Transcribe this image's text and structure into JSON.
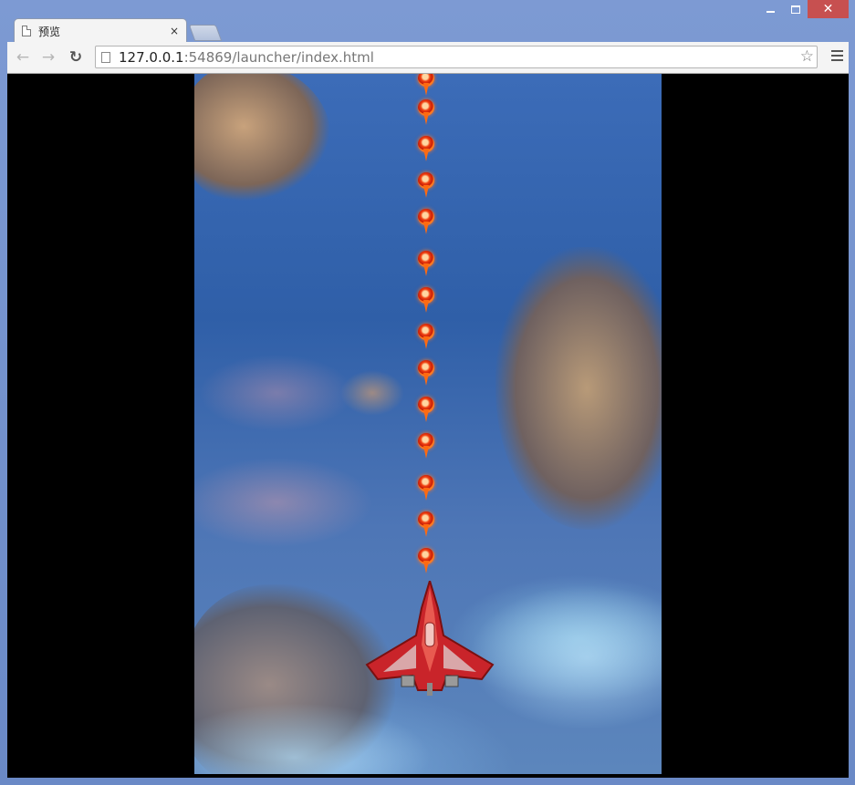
{
  "browser": {
    "tab": {
      "title": "预览",
      "close_glyph": "×"
    },
    "window_controls": {
      "minimize_icon": "minimize-icon",
      "maximize_icon": "maximize-icon",
      "close_glyph": "✕"
    },
    "toolbar": {
      "back_glyph": "←",
      "forward_glyph": "→",
      "reload_glyph": "↻",
      "url_host": "127.0.0.1",
      "url_rest": ":54869/launcher/index.html",
      "star_glyph": "☆"
    },
    "colors": {
      "frame": "#6f8ec9",
      "close_button": "#c75050",
      "viewport": "#000000"
    }
  },
  "game": {
    "bullet_count": 14,
    "player": {
      "name": "red-fighter-jet"
    }
  }
}
